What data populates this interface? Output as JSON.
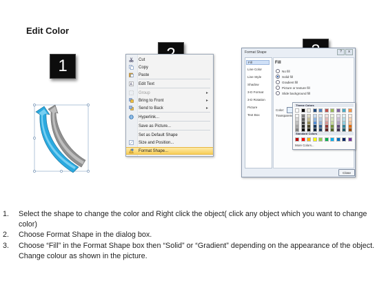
{
  "title": "Edit Color",
  "steps_badges": [
    "1",
    "2",
    "3"
  ],
  "context_menu": {
    "items": [
      {
        "label": "Cut",
        "icon": "scissors-icon",
        "enabled": true,
        "submenu": false
      },
      {
        "label": "Copy",
        "icon": "copy-icon",
        "enabled": true,
        "submenu": false
      },
      {
        "label": "Paste",
        "icon": "paste-icon",
        "enabled": true,
        "submenu": false
      },
      {
        "label": "Edit Text",
        "icon": "edit-text-icon",
        "enabled": true,
        "submenu": false
      },
      {
        "label": "Group",
        "icon": "group-icon",
        "enabled": false,
        "submenu": true
      },
      {
        "label": "Bring to Front",
        "icon": "bring-front-icon",
        "enabled": true,
        "submenu": true
      },
      {
        "label": "Send to Back",
        "icon": "send-back-icon",
        "enabled": true,
        "submenu": true
      },
      {
        "label": "Hyperlink...",
        "icon": "hyperlink-icon",
        "enabled": true,
        "submenu": false
      },
      {
        "label": "Save as Picture...",
        "icon": "",
        "enabled": true,
        "submenu": false
      },
      {
        "label": "Set as Default Shape",
        "icon": "",
        "enabled": true,
        "submenu": false
      },
      {
        "label": "Size and Position...",
        "icon": "size-icon",
        "enabled": true,
        "submenu": false
      },
      {
        "label": "Format Shape...",
        "icon": "format-shape-icon",
        "enabled": true,
        "submenu": false,
        "highlighted": true
      }
    ]
  },
  "dialog": {
    "title": "Format Shape",
    "controls": [
      "?",
      "x"
    ],
    "nav": [
      "Fill",
      "Line Color",
      "Line Style",
      "Shadow",
      "3-D Format",
      "3-D Rotation",
      "Picture",
      "Text Box"
    ],
    "section": "Fill",
    "fill_options": [
      "No fill",
      "Solid fill",
      "Gradient fill",
      "Picture or texture fill",
      "Slide background fill"
    ],
    "selected_fill": "Solid fill",
    "color_label": "Color:",
    "transparency_label": "Transparency:",
    "palette": {
      "theme_header": "Theme Colors",
      "standard_header": "Standard Colors",
      "more": "More Colors...",
      "theme_top": [
        "#ffffff",
        "#000000",
        "#eeece1",
        "#1f497d",
        "#4f81bd",
        "#c0504d",
        "#9bbb59",
        "#8064a2",
        "#4bacc6",
        "#f79646"
      ],
      "theme_shades": [
        [
          "#f2f2f2",
          "#7f7f7f",
          "#ddd9c3",
          "#c6d9f0",
          "#dbe5f1",
          "#f2dcdb",
          "#ebf1dd",
          "#e5e0ec",
          "#dbeef3",
          "#fdeada"
        ],
        [
          "#d8d8d8",
          "#595959",
          "#c4bd97",
          "#8db3e2",
          "#b8cce4",
          "#e5b9b7",
          "#d7e3bc",
          "#ccc1d9",
          "#b7dde8",
          "#fbd5b5"
        ],
        [
          "#bfbfbf",
          "#3f3f3f",
          "#938953",
          "#548dd4",
          "#95b3d7",
          "#d99694",
          "#c3d69b",
          "#b2a2c7",
          "#92cddc",
          "#fac08f"
        ],
        [
          "#a5a5a5",
          "#262626",
          "#494429",
          "#17365d",
          "#366092",
          "#953734",
          "#76923c",
          "#5f497a",
          "#31859b",
          "#e36c09"
        ],
        [
          "#7f7f7f",
          "#0c0c0c",
          "#1d1b10",
          "#0f243e",
          "#244061",
          "#632423",
          "#4f6128",
          "#3f3151",
          "#205867",
          "#974806"
        ]
      ],
      "standard": [
        "#c00000",
        "#ff0000",
        "#ffc000",
        "#ffff00",
        "#92d050",
        "#00b050",
        "#00b0f0",
        "#0070c0",
        "#002060",
        "#7030a0"
      ]
    },
    "close_label": "Close"
  },
  "instructions": [
    {
      "num": "1.",
      "text": "Select the shape to change the color and Right click the object( click any object which you want to change color)"
    },
    {
      "num": "2.",
      "text": "Choose Format Shape in the dialog box."
    },
    {
      "num": "3.",
      "text": "Choose “Fill” in the Format Shape box then “Solid” or “Gradient” depending on the appearance of the object. Change colour as shown in the picture."
    }
  ]
}
